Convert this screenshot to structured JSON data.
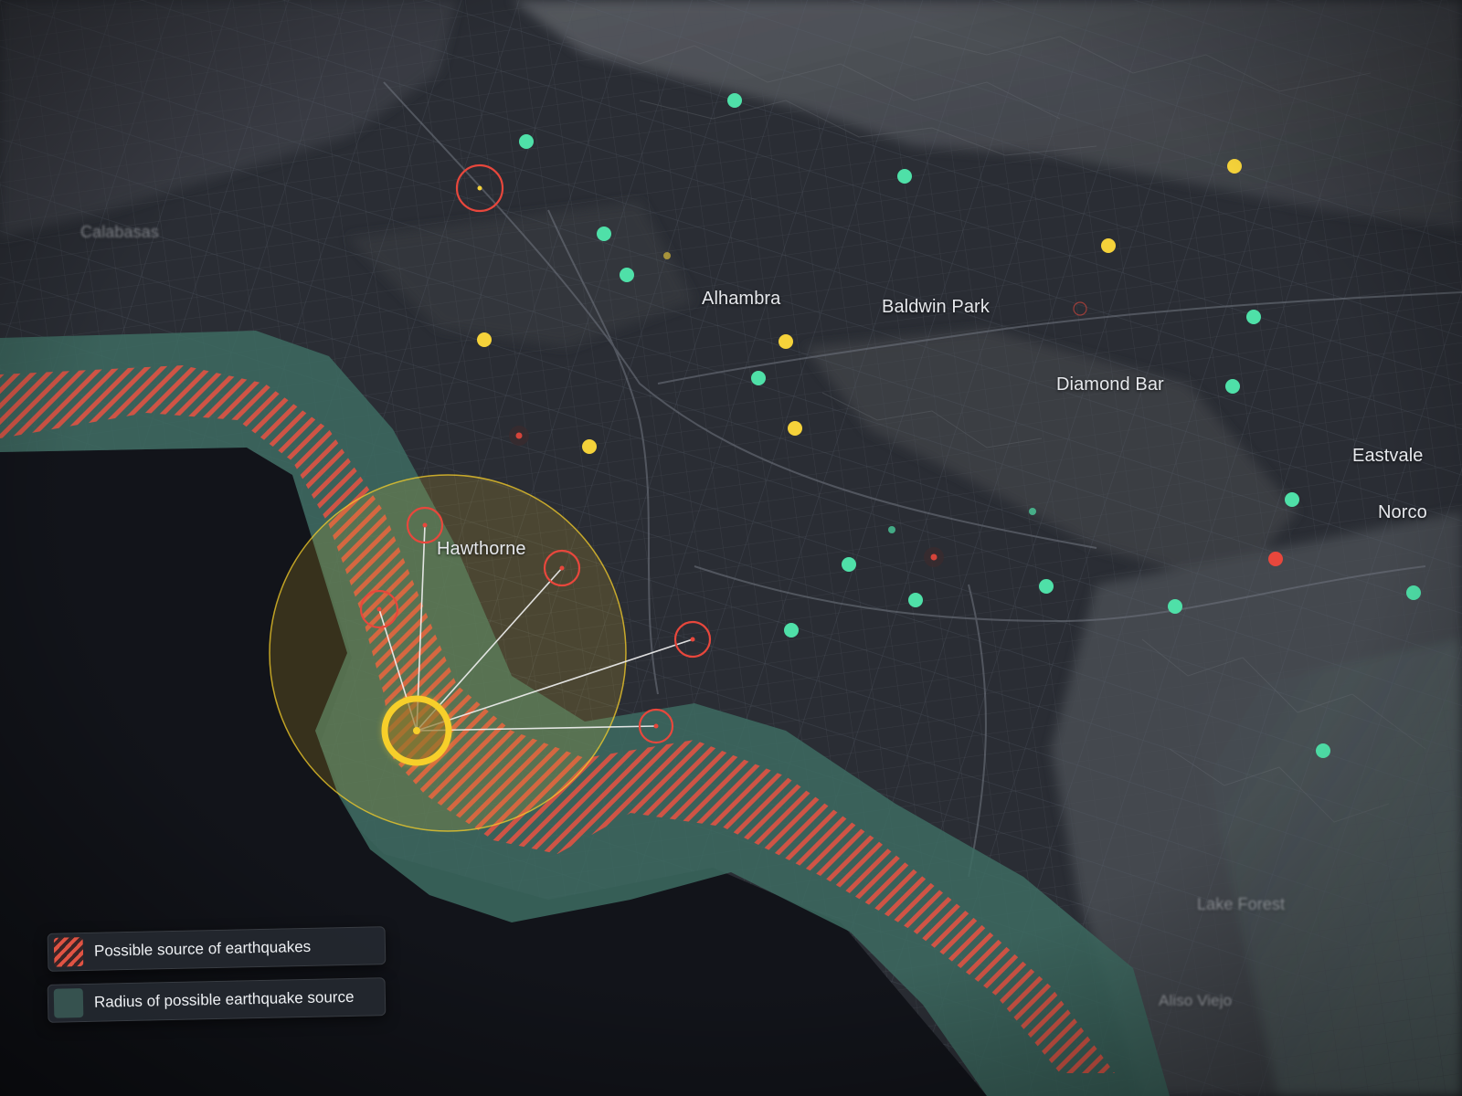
{
  "map": {
    "cities": [
      {
        "name": "Alhambra"
      },
      {
        "name": "Baldwin Park"
      },
      {
        "name": "Diamond Bar"
      },
      {
        "name": "Eastvale"
      },
      {
        "name": "Norco"
      },
      {
        "name": "Hawthorne"
      },
      {
        "name": "Lake Forest"
      },
      {
        "name": "Calabasas"
      },
      {
        "name": "Aliso Viejo"
      }
    ],
    "colors": {
      "land": "#2a2d34",
      "ocean": "#12141a",
      "grid": "#4a4f58",
      "station_green": "#4fe0a8",
      "station_yellow": "#f5d23a",
      "station_red": "#e8473c",
      "fault_hatch": "#e05343",
      "radius_zone": "#3d6b62",
      "epicenter": "#f7cf2a"
    },
    "markers": {
      "green_stations": 22,
      "yellow_stations": 10,
      "red_rings": 7,
      "epicenter": "main-epicenter"
    },
    "icons": [
      "hatch-swatch-icon",
      "radius-swatch-icon",
      "epicenter-icon",
      "station-icon",
      "alert-ring-icon"
    ]
  },
  "legend": {
    "items": [
      {
        "label": "Possible source of earthquakes",
        "icon": "hatch-swatch-icon"
      },
      {
        "label": "Radius of possible earthquake source",
        "icon": "radius-swatch-icon"
      }
    ]
  }
}
